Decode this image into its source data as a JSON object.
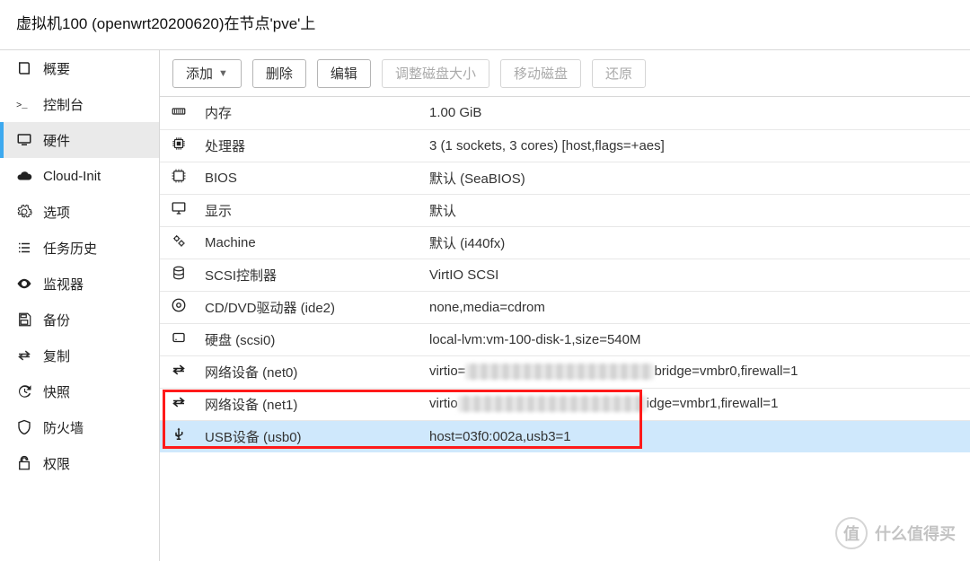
{
  "header": {
    "title": "虚拟机100 (openwrt20200620)在节点'pve'上"
  },
  "sidebar": {
    "items": [
      {
        "id": "summary",
        "label": "概要",
        "icon": "book-icon"
      },
      {
        "id": "console",
        "label": "控制台",
        "icon": "terminal-icon"
      },
      {
        "id": "hardware",
        "label": "硬件",
        "icon": "monitor-icon",
        "active": true
      },
      {
        "id": "cloudinit",
        "label": "Cloud-Init",
        "icon": "cloud-icon"
      },
      {
        "id": "options",
        "label": "选项",
        "icon": "gear-icon"
      },
      {
        "id": "tasks",
        "label": "任务历史",
        "icon": "list-icon"
      },
      {
        "id": "monitor",
        "label": "监视器",
        "icon": "eye-icon"
      },
      {
        "id": "backup",
        "label": "备份",
        "icon": "save-icon"
      },
      {
        "id": "replicate",
        "label": "复制",
        "icon": "replication-icon"
      },
      {
        "id": "snapshot",
        "label": "快照",
        "icon": "history-icon"
      },
      {
        "id": "firewall",
        "label": "防火墙",
        "icon": "shield-icon"
      },
      {
        "id": "perms",
        "label": "权限",
        "icon": "unlock-icon"
      }
    ]
  },
  "toolbar": {
    "add": "添加",
    "remove": "删除",
    "edit": "编辑",
    "resize": "调整磁盘大小",
    "move": "移动磁盘",
    "revert": "还原"
  },
  "hardware": [
    {
      "icon": "memory-icon",
      "label": "内存",
      "value": "1.00 GiB"
    },
    {
      "icon": "cpu-icon",
      "label": "处理器",
      "value": "3 (1 sockets, 3 cores) [host,flags=+aes]"
    },
    {
      "icon": "chip-icon",
      "label": "BIOS",
      "value": "默认 (SeaBIOS)"
    },
    {
      "icon": "display-icon",
      "label": "显示",
      "value": "默认"
    },
    {
      "icon": "cogs-icon",
      "label": "Machine",
      "value": "默认 (i440fx)"
    },
    {
      "icon": "database-icon",
      "label": "SCSI控制器",
      "value": "VirtIO SCSI"
    },
    {
      "icon": "disc-icon",
      "label": "CD/DVD驱动器 (ide2)",
      "value": "none,media=cdrom"
    },
    {
      "icon": "hdd-icon",
      "label": "硬盘 (scsi0)",
      "value": "local-lvm:vm-100-disk-1,size=540M"
    },
    {
      "icon": "network-icon",
      "label": "网络设备 (net0)",
      "value_pre": "virtio=",
      "censored": true,
      "value_post": "bridge=vmbr0,firewall=1"
    },
    {
      "icon": "network-icon",
      "label": "网络设备 (net1)",
      "value_pre": "virtio",
      "censored": true,
      "value_post": "idge=vmbr1,firewall=1"
    },
    {
      "icon": "usb-icon",
      "label": "USB设备 (usb0)",
      "value": "host=03f0:002a,usb3=1",
      "selected": true
    }
  ],
  "watermark": {
    "glyph": "值",
    "text": "什么值得买"
  }
}
